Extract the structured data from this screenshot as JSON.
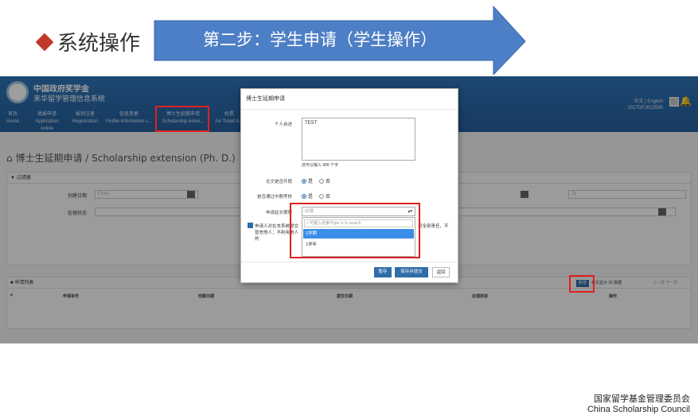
{
  "slide": {
    "section_title": "系统操作",
    "step_label": "第二步：学生申请（学生操作）",
    "footer_cn": "国家留学基金管理委员会",
    "footer_en": "China Scholarship Council",
    "accent": "#2f6da8",
    "highlight": "#e02020"
  },
  "app": {
    "name_cn": "中国政府奖学金",
    "name_sub": "来华留学管理信息系统",
    "lang": "中文 | English",
    "user_id": "2017DFJ013595",
    "nav": [
      {
        "cn": "首页",
        "en": "Home"
      },
      {
        "cn": "填报申请",
        "en": "Application online"
      },
      {
        "cn": "报到注册",
        "en": "Registration"
      },
      {
        "cn": "信息变更",
        "en": "Profile information c..."
      },
      {
        "cn": "博士生延期申请",
        "en": "Scholarship exten..."
      },
      {
        "cn": "机票",
        "en": "Air Ticket A..."
      }
    ]
  },
  "page": {
    "heading": "博士生延期申请 / Scholarship extension (Ph. D.)",
    "filter_title": "过滤器",
    "created_date_label": "创建日期",
    "status_label": "处理状态",
    "from_placeholder": "From",
    "to_placeholder": "To",
    "list_title": "申请列表",
    "columns": [
      "#",
      "申请单号",
      "创建日期",
      "提交日期",
      "处理状态",
      "操作"
    ],
    "add_label": "新增",
    "per_page_prefix": "每页显示",
    "per_page_value": "20",
    "per_page_suffix": "数据",
    "prev": "上一页",
    "next": "下一页"
  },
  "modal": {
    "title": "博士生延期申请",
    "statement_label": "个人自述",
    "statement_value": "TEST",
    "remaining_chars": "还可以输入 996 个字",
    "thesis_label": "论文是否开题",
    "midterm_label": "是否通过中期考核",
    "yes": "是",
    "no": "否",
    "ext_label": "申请延长期限",
    "ext_placeholder": "必填",
    "search_placeholder": "可键入检索/Type in to search",
    "options": [
      "1学期",
      "1学年"
    ],
    "commit_text": "申请人对在本系统提交",
    "commit_tail": "担全部责任，不",
    "commit_line2": "冒充他人；不利用他人的",
    "save": "暂存",
    "save_submit": "保存并提交",
    "back": "返回"
  }
}
